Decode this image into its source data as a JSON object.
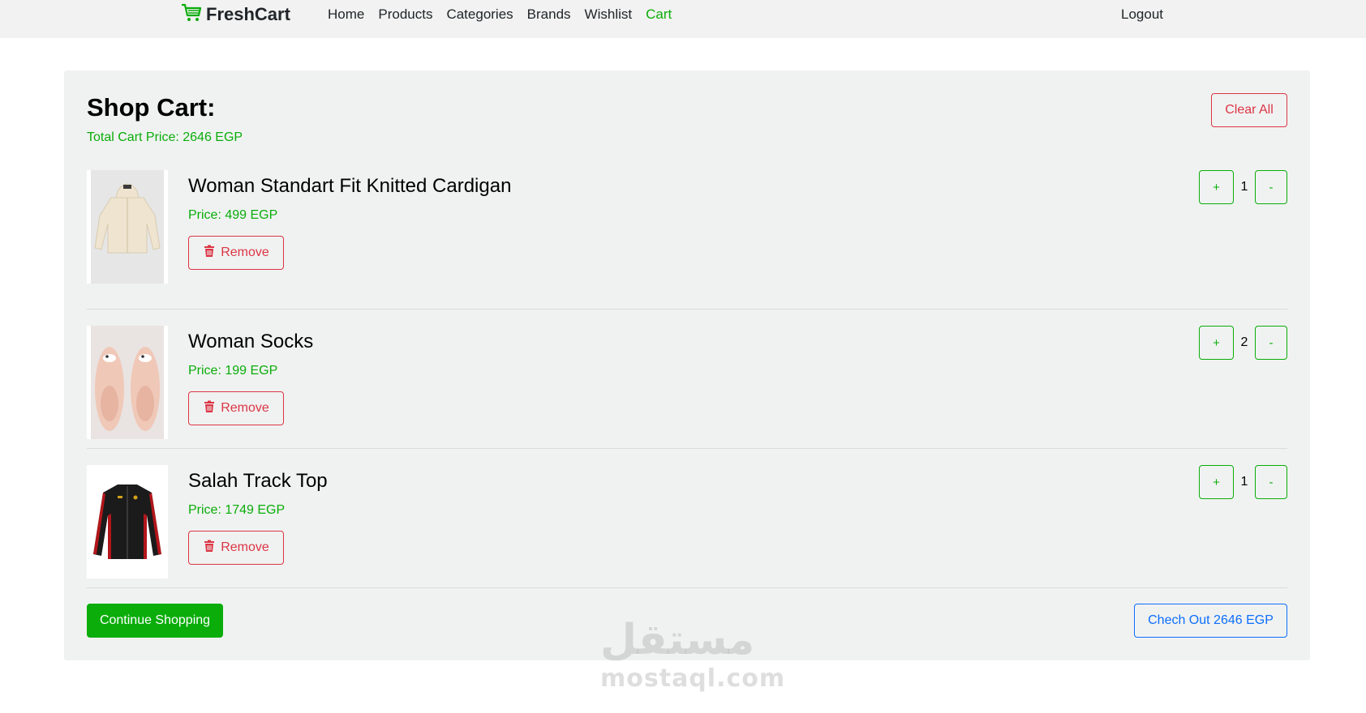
{
  "nav": {
    "brand": "FreshCart",
    "links": [
      "Home",
      "Products",
      "Categories",
      "Brands",
      "Wishlist",
      "Cart"
    ],
    "active": "Cart",
    "logout": "Logout"
  },
  "cart": {
    "title": "Shop Cart:",
    "total": "Total Cart Price: 2646 EGP",
    "clear_label": "Clear All",
    "remove_label": "Remove",
    "plus_label": "+",
    "minus_label": "-",
    "items": [
      {
        "name": "Woman Standart Fit Knitted Cardigan",
        "price": "Price: 499 EGP",
        "qty": "1"
      },
      {
        "name": "Woman Socks",
        "price": "Price: 199 EGP",
        "qty": "2"
      },
      {
        "name": "Salah Track Top",
        "price": "Price: 1749 EGP",
        "qty": "1"
      }
    ],
    "continue_label": "Continue Shopping",
    "checkout_label": "Chech Out 2646 EGP"
  },
  "watermark": {
    "arabic": "مستقل",
    "latin": "mostaql.com"
  },
  "colors": {
    "green": "#0aad0a",
    "red": "#dc3545",
    "blue": "#0d6efd",
    "card_bg": "#f0f2f1"
  }
}
